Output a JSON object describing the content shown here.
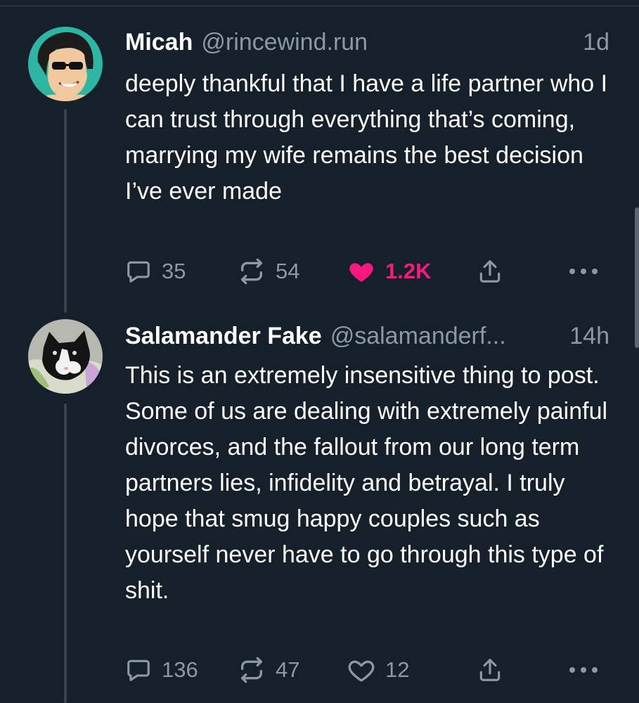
{
  "posts": [
    {
      "name": "Micah",
      "handle": "@rincewind.run",
      "time": "1d",
      "text": "deeply thankful that I have a life partner who I can trust through everything that’s coming, marrying my wife remains the best decision I’ve ever made",
      "replies": "35",
      "reposts": "54",
      "likes": "1.2K",
      "liked": true
    },
    {
      "name": "Salamander Fake",
      "handle": "@salamanderf...",
      "time": "14h",
      "text": "This is an extremely insensitive thing to post. Some of us are dealing with extremely painful divorces, and the fallout from our long term partners lies, infidelity and betrayal. I truly hope that smug happy couples such as yourself never have to go through this type of shit.",
      "replies": "136",
      "reposts": "47",
      "likes": "12",
      "liked": false
    }
  ],
  "colors": {
    "background": "#15202b",
    "secondary_text": "#8b98a5",
    "like_active": "#f91880",
    "thread_line": "#38444d"
  },
  "icons": [
    "reply-icon",
    "repost-icon",
    "like-icon",
    "share-icon",
    "more-icon"
  ]
}
